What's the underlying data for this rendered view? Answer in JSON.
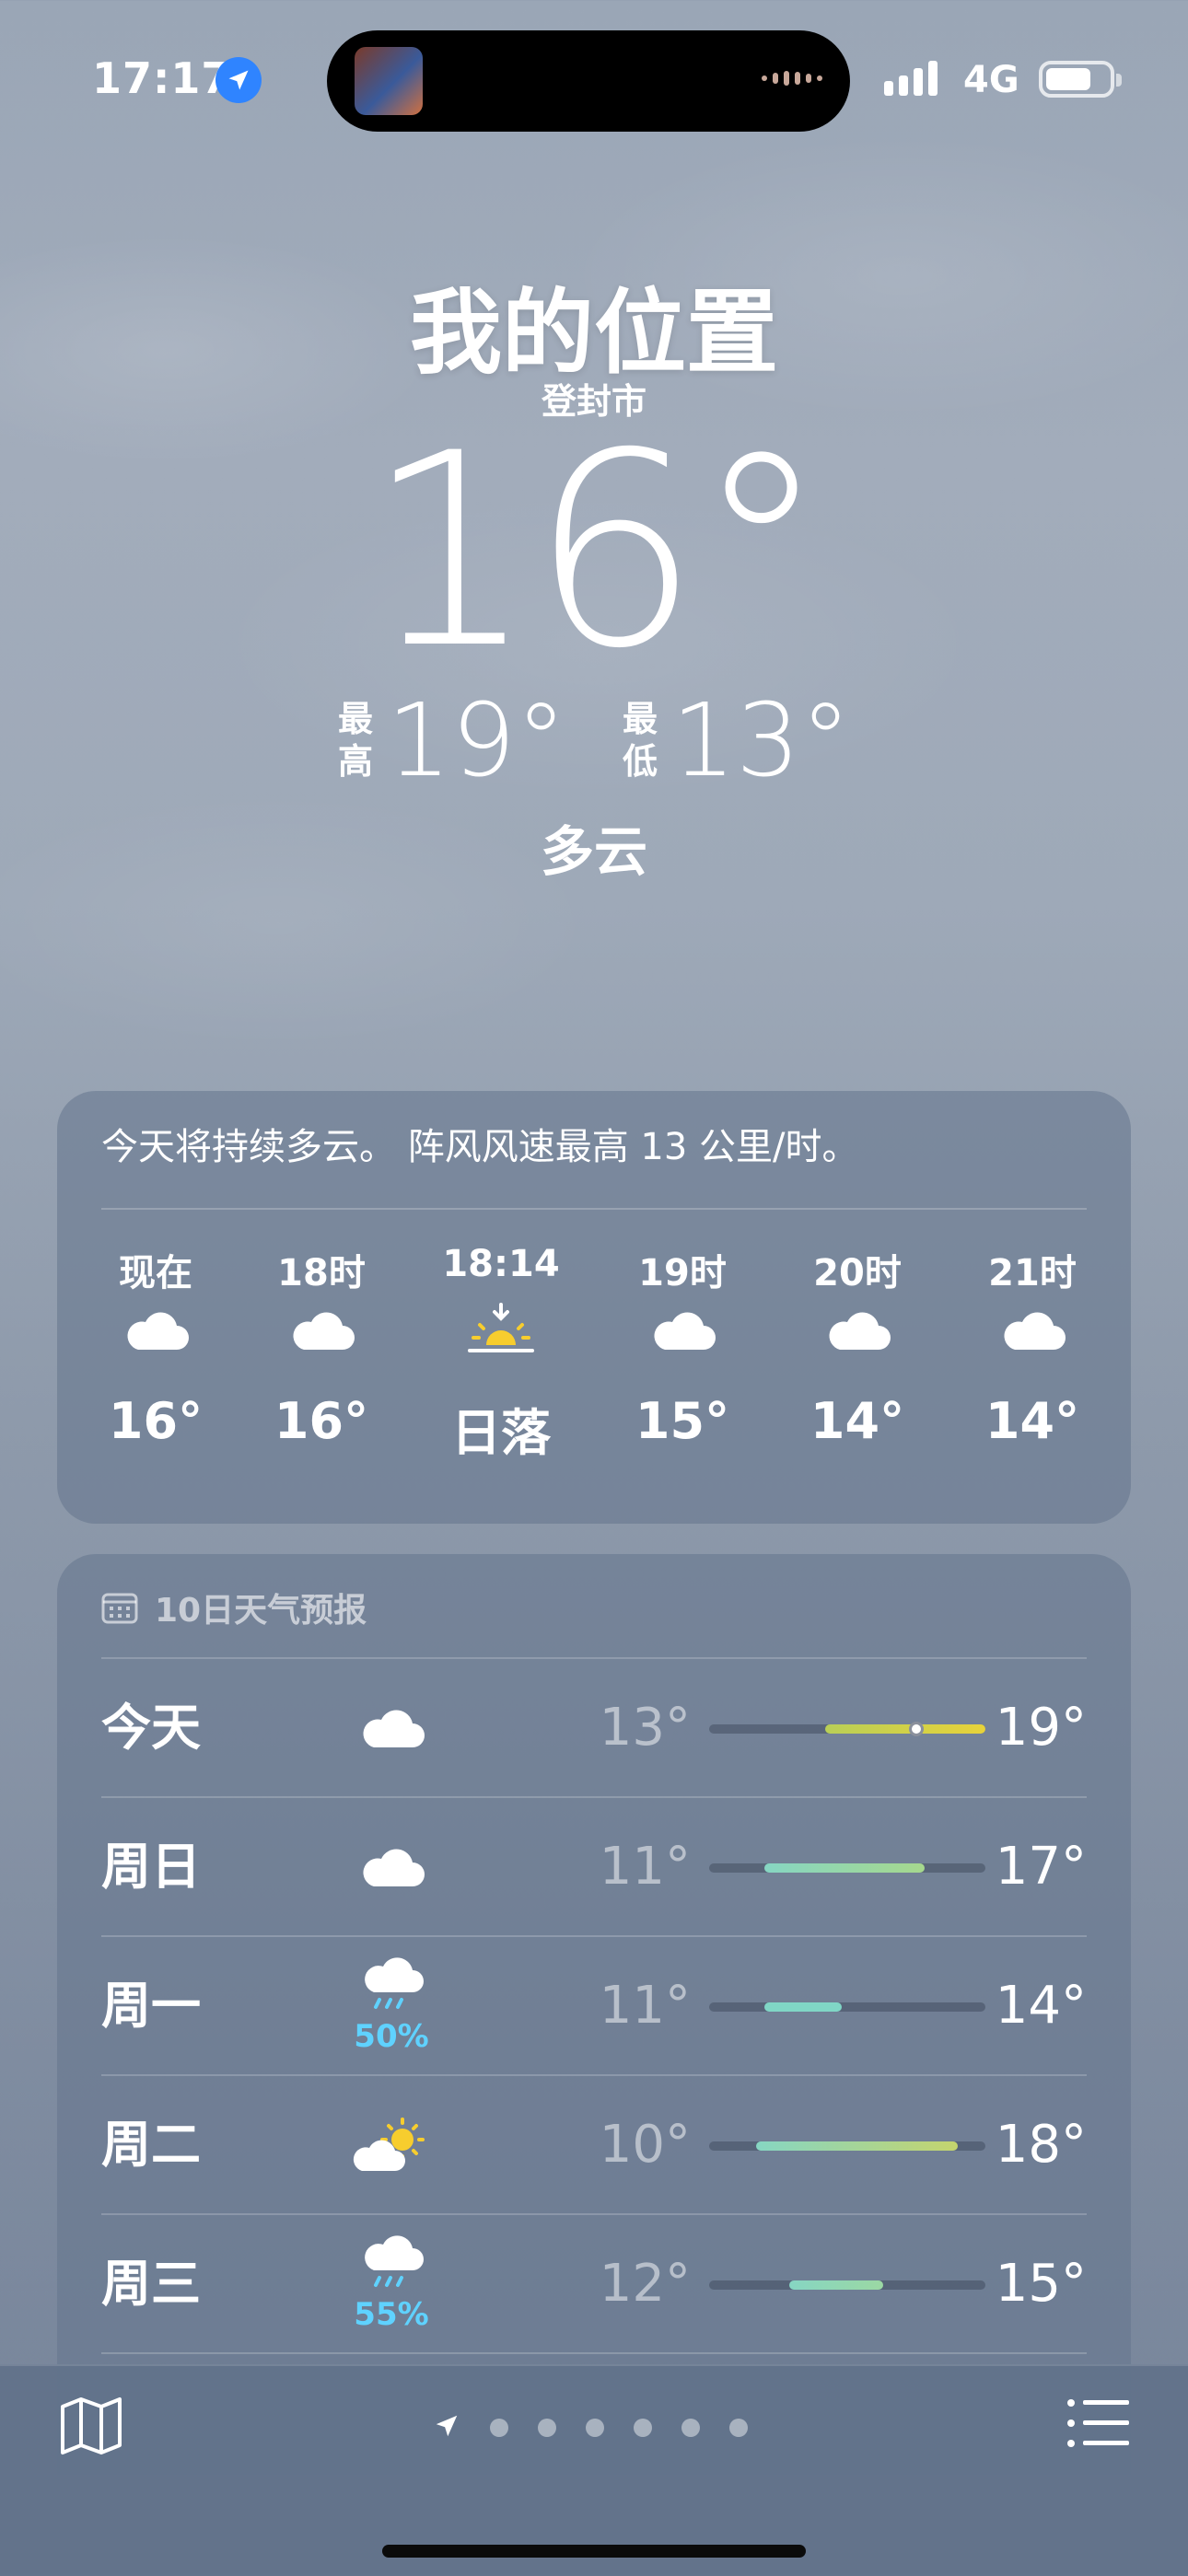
{
  "status_bar": {
    "time": "17:17",
    "network": "4G",
    "location_icon": "location-arrow-icon"
  },
  "header": {
    "location_title": "我的位置",
    "city": "登封市",
    "current_temp": "16°",
    "high_label": "最高",
    "high": "19°",
    "low_label": "最低",
    "low": "13°",
    "condition": "多云"
  },
  "hourly": {
    "summary": "今天将持续多云。 阵风风速最高 13 公里/时。",
    "items": [
      {
        "label": "现在",
        "icon": "cloud-icon",
        "temp": "16°"
      },
      {
        "label": "18时",
        "icon": "cloud-icon",
        "temp": "16°"
      },
      {
        "label": "18:14",
        "icon": "sunset-icon",
        "temp": "日落"
      },
      {
        "label": "19时",
        "icon": "cloud-icon",
        "temp": "15°"
      },
      {
        "label": "20时",
        "icon": "cloud-icon",
        "temp": "14°"
      },
      {
        "label": "21时",
        "icon": "cloud-icon",
        "temp": "14°"
      }
    ]
  },
  "daily": {
    "header": "10日天气预报",
    "header_icon": "calendar-icon",
    "days": [
      {
        "day": "今天",
        "icon": "cloud-icon",
        "precip": "",
        "low": "13°",
        "high": "19°",
        "bar_start": 0.42,
        "bar_end": 1.0,
        "current_marker": 0.75,
        "colors": [
          "#b9cf57",
          "#e8d33a"
        ]
      },
      {
        "day": "周日",
        "icon": "cloud-icon",
        "precip": "",
        "low": "11°",
        "high": "17°",
        "bar_start": 0.2,
        "bar_end": 0.78,
        "current_marker": null,
        "colors": [
          "#86d6c3",
          "#a6d88d"
        ]
      },
      {
        "day": "周一",
        "icon": "cloud-rain-icon",
        "precip": "50%",
        "low": "11°",
        "high": "14°",
        "bar_start": 0.2,
        "bar_end": 0.48,
        "current_marker": null,
        "colors": [
          "#80d6c6",
          "#80d6c6"
        ]
      },
      {
        "day": "周二",
        "icon": "partly-sunny-icon",
        "precip": "",
        "low": "10°",
        "high": "18°",
        "bar_start": 0.17,
        "bar_end": 0.9,
        "current_marker": null,
        "colors": [
          "#86d6c3",
          "#c5d46d"
        ]
      },
      {
        "day": "周三",
        "icon": "cloud-rain-icon",
        "precip": "55%",
        "low": "12°",
        "high": "15°",
        "bar_start": 0.29,
        "bar_end": 0.63,
        "current_marker": null,
        "colors": [
          "#86d6c3",
          "#9bd8a3"
        ]
      }
    ]
  },
  "bottom_bar": {
    "map_icon": "map-icon",
    "page_count": 6,
    "list_icon": "list-icon"
  }
}
